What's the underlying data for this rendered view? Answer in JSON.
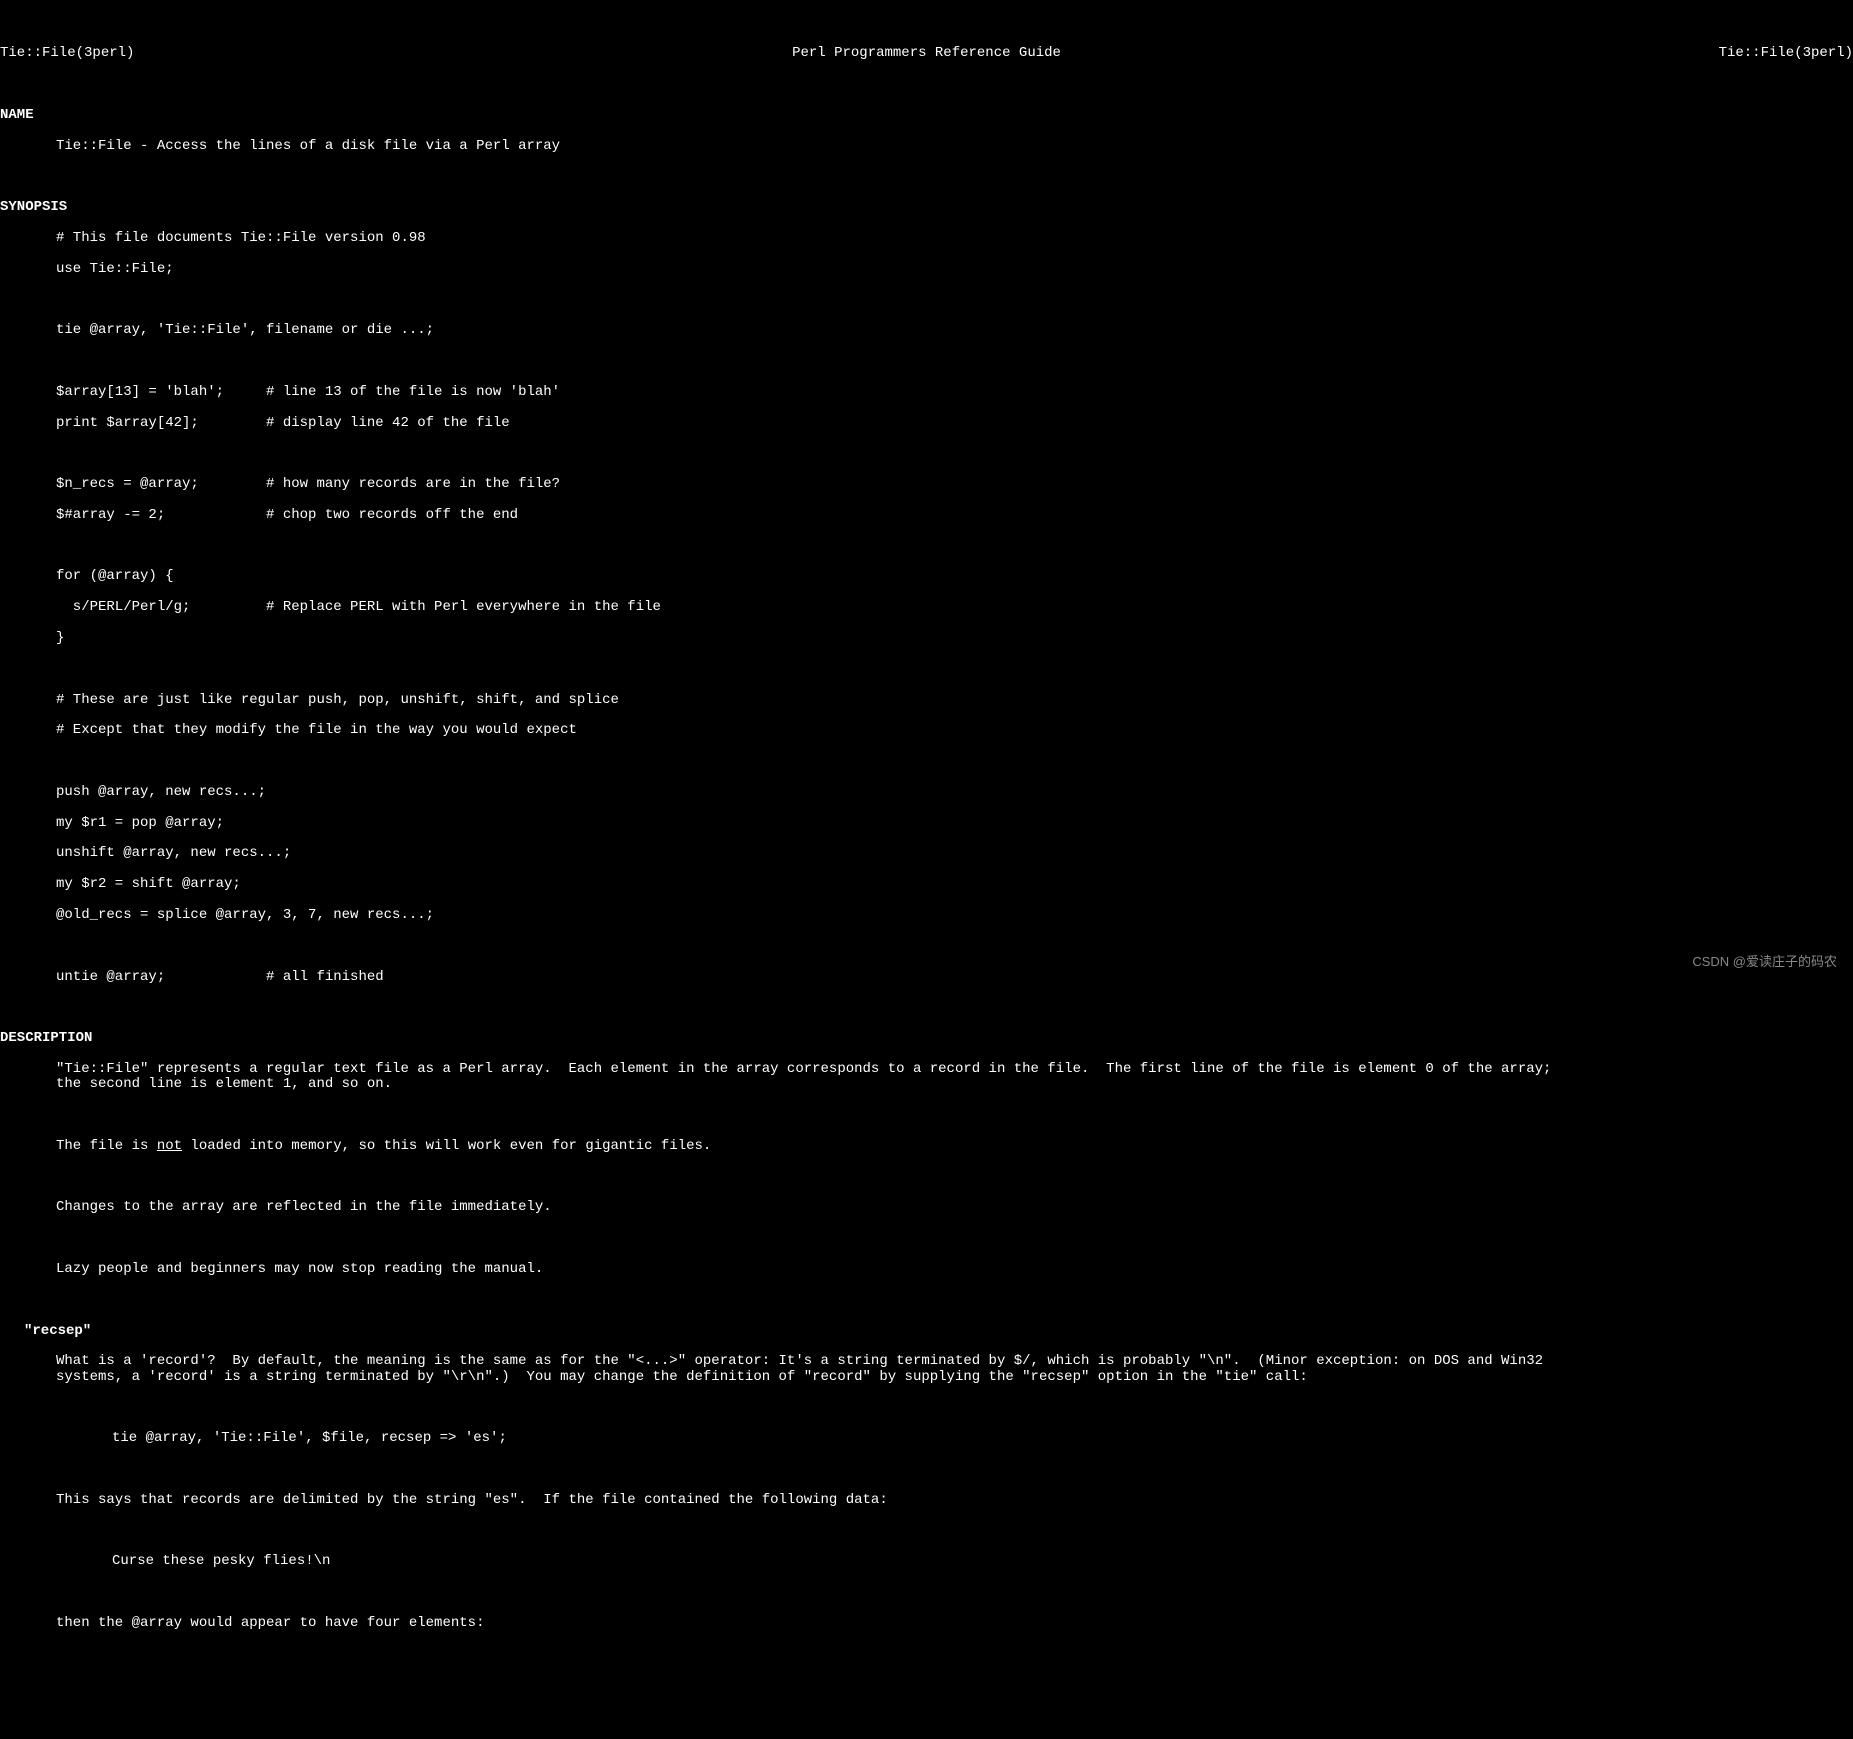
{
  "header": {
    "left": "Tie::File(3perl)",
    "center": "Perl Programmers Reference Guide",
    "right": "Tie::File(3perl)"
  },
  "sections": {
    "name": {
      "header": "NAME",
      "content": "Tie::File - Access the lines of a disk file via a Perl array"
    },
    "synopsis": {
      "header": "SYNOPSIS",
      "lines": [
        "# This file documents Tie::File version 0.98",
        "use Tie::File;",
        "",
        "tie @array, 'Tie::File', filename or die ...;",
        "",
        "$array[13] = 'blah';     # line 13 of the file is now 'blah'",
        "print $array[42];        # display line 42 of the file",
        "",
        "$n_recs = @array;        # how many records are in the file?",
        "$#array -= 2;            # chop two records off the end",
        "",
        "for (@array) {",
        "  s/PERL/Perl/g;         # Replace PERL with Perl everywhere in the file",
        "}",
        "",
        "# These are just like regular push, pop, unshift, shift, and splice",
        "# Except that they modify the file in the way you would expect",
        "",
        "push @array, new recs...;",
        "my $r1 = pop @array;",
        "unshift @array, new recs...;",
        "my $r2 = shift @array;",
        "@old_recs = splice @array, 3, 7, new recs...;",
        "",
        "untie @array;            # all finished"
      ]
    },
    "description": {
      "header": "DESCRIPTION",
      "para1": "\"Tie::File\" represents a regular text file as a Perl array.  Each element in the array corresponds to a record in the file.  The first line of the file is element 0 of the array;\nthe second line is element 1, and so on.",
      "para2_pre": "The file is ",
      "para2_not": "not",
      "para2_post": " loaded into memory, so this will work even for gigantic files.",
      "para3": "Changes to the array are reflected in the file immediately.",
      "para4": "Lazy people and beginners may now stop reading the manual."
    },
    "recsep": {
      "header": "\"recsep\"",
      "para1": "What is a 'record'?  By default, the meaning is the same as for the \"<...>\" operator: It's a string terminated by $/, which is probably \"\\n\".  (Minor exception: on DOS and Win32\nsystems, a 'record' is a string terminated by \"\\r\\n\".)  You may change the definition of \"record\" by supplying the \"recsep\" option in the \"tie\" call:",
      "code1": "tie @array, 'Tie::File', $file, recsep => 'es';",
      "para2": "This says that records are delimited by the string \"es\".  If the file contained the following data:",
      "code2": "Curse these pesky flies!\\n",
      "para3": "then the @array would appear to have four elements:"
    }
  },
  "watermark": "CSDN @爱读庄子的码农"
}
